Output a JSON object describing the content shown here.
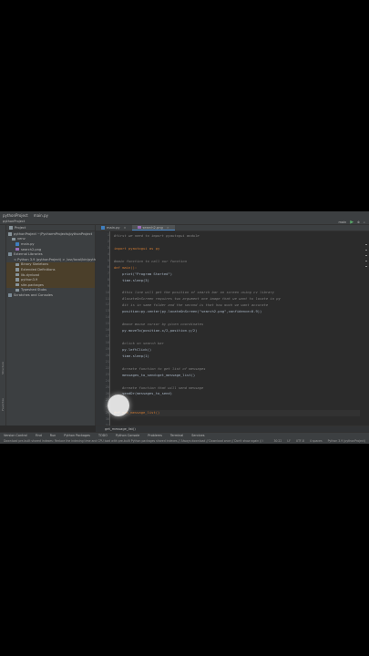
{
  "titlebar": {
    "project": "pythonProject",
    "file": "main.py"
  },
  "toolbar": {
    "crumb": "pythonProject",
    "run_config": "main"
  },
  "project_panel": {
    "header": "Project",
    "items": [
      {
        "label": "pythonProject ~/PycharmProjects/pythonProject",
        "icon": "folder-icon"
      },
      {
        "label": "venv",
        "icon": "folder-icon"
      },
      {
        "label": "main.py",
        "icon": "python-file-icon"
      },
      {
        "label": "search2.png",
        "icon": "image-file-icon"
      },
      {
        "label": "External Libraries",
        "icon": "library-icon"
      },
      {
        "label": "< Python 3.9 (pythonProject) > /usr/local/bin/python3.9",
        "icon": "python-icon"
      },
      {
        "label": "Binary Skeletons",
        "icon": "folder-icon"
      },
      {
        "label": "Extended Definitions",
        "icon": "folder-icon"
      },
      {
        "label": "lib-dynload",
        "icon": "folder-icon"
      },
      {
        "label": "python3.9",
        "icon": "folder-icon"
      },
      {
        "label": "site-packages",
        "icon": "folder-icon"
      },
      {
        "label": "Typeshed Stubs",
        "icon": "folder-icon"
      },
      {
        "label": "Scratches and Consoles",
        "icon": "scratches-icon"
      }
    ]
  },
  "left_tool_labels": {
    "structure": "Structure",
    "favorites": "Favorites"
  },
  "tabs": [
    {
      "label": "main.py"
    },
    {
      "label": "search2.png"
    }
  ],
  "code_lines": [
    {
      "n": "1",
      "text": "#first we need to import pyautogui module",
      "kind": "comment"
    },
    {
      "n": "2",
      "text": "",
      "kind": "code"
    },
    {
      "n": "3",
      "text": "import pyautogui as py",
      "kind": "kw"
    },
    {
      "n": "4",
      "text": "",
      "kind": "code"
    },
    {
      "n": "5",
      "text": "#main function to call our function",
      "kind": "comment"
    },
    {
      "n": "6",
      "text": "def main():",
      "kind": "kw"
    },
    {
      "n": "7",
      "text": "    print(\"Program Started\")",
      "kind": "code"
    },
    {
      "n": "8",
      "text": "    time.sleep(3)",
      "kind": "code"
    },
    {
      "n": "9",
      "text": "",
      "kind": "code"
    },
    {
      "n": "10",
      "text": "    #this line will get the position of search bar on screen using cv library",
      "kind": "comment"
    },
    {
      "n": "11",
      "text": "    #locateOnScreen requires two argument one image that we want to locate in py",
      "kind": "comment"
    },
    {
      "n": "12",
      "text": "    #it is in same folder and the second is that how much we want accurate",
      "kind": "comment"
    },
    {
      "n": "13",
      "text": "    position=py.center(py.locateOnScreen(\"search2.png\",confidence=0.9))",
      "kind": "code"
    },
    {
      "n": "14",
      "text": "",
      "kind": "code"
    },
    {
      "n": "15",
      "text": "    #move mouse cursor by given coordinates",
      "kind": "comment"
    },
    {
      "n": "16",
      "text": "    py.moveTo(position.x/2,position.y/2)",
      "kind": "code"
    },
    {
      "n": "17",
      "text": "",
      "kind": "code"
    },
    {
      "n": "18",
      "text": "    #click on search bar",
      "kind": "comment"
    },
    {
      "n": "19",
      "text": "    py.leftClick()",
      "kind": "code"
    },
    {
      "n": "20",
      "text": "    time.sleep(1)",
      "kind": "code"
    },
    {
      "n": "21",
      "text": "",
      "kind": "code"
    },
    {
      "n": "22",
      "text": "    #create function to get list of messages",
      "kind": "comment"
    },
    {
      "n": "23",
      "text": "    messages_to_send=get_message_list()",
      "kind": "code"
    },
    {
      "n": "24",
      "text": "",
      "kind": "code"
    },
    {
      "n": "25",
      "text": "    #create function that will send message",
      "kind": "comment"
    },
    {
      "n": "26",
      "text": "    sendDr(messages_to_send)",
      "kind": "code"
    },
    {
      "n": "27",
      "text": "",
      "kind": "code"
    },
    {
      "n": "28",
      "text": "",
      "kind": "code"
    },
    {
      "n": "29",
      "text": "def get_message_list()",
      "kind": "kw"
    },
    {
      "n": "30",
      "text": "",
      "kind": "code"
    },
    {
      "n": "31",
      "text": "",
      "kind": "code"
    }
  ],
  "breadcrumb_bottom": "get_message_list()",
  "bottom_tools": [
    "Version Control",
    "Find",
    "Run",
    "Python Packages",
    "TODO",
    "Python Console",
    "Problems",
    "Terminal",
    "Services"
  ],
  "status": {
    "message": "Download pre-built shared indexes: Reduce the indexing time and CPU load with pre-built Python packages shared indexes // Always download // Download once // Don't show again // Configure... (today 1:53 pm)",
    "position": "30:22",
    "line_sep": "LF",
    "encoding": "UTF-8",
    "indent": "4 spaces",
    "interpreter": "Python 3.9 (pythonProject)"
  }
}
